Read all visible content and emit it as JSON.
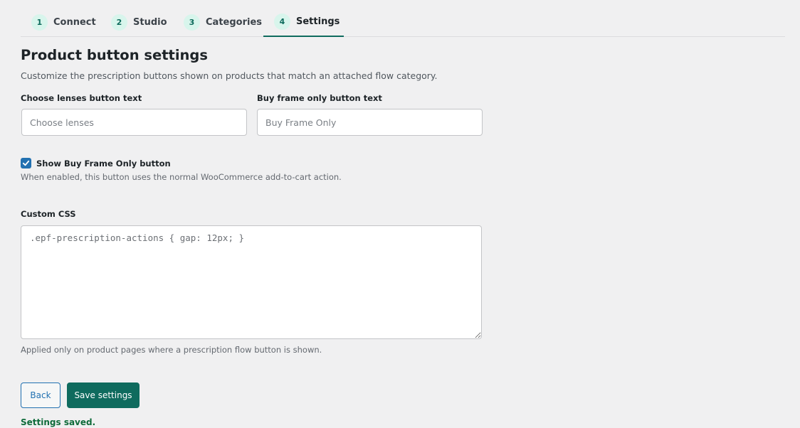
{
  "tabs": [
    {
      "num": "1",
      "label": "Connect"
    },
    {
      "num": "2",
      "label": "Studio"
    },
    {
      "num": "3",
      "label": "Categories"
    },
    {
      "num": "4",
      "label": "Settings"
    }
  ],
  "active_tab": "Settings",
  "page": {
    "title": "Product button settings",
    "subtitle": "Customize the prescription buttons shown on products that match an attached flow category."
  },
  "fields": {
    "choose_lenses": {
      "label": "Choose lenses button text",
      "value": "",
      "placeholder": "Choose lenses"
    },
    "buy_frame": {
      "label": "Buy frame only button text",
      "value": "",
      "placeholder": "Buy Frame Only"
    }
  },
  "show_buy_frame": {
    "label": "Show Buy Frame Only button",
    "checked": true,
    "hint": "When enabled, this button uses the normal WooCommerce add-to-cart action."
  },
  "custom_css": {
    "label": "Custom CSS",
    "value": "",
    "placeholder": ".epf-prescription-actions { gap: 12px; }",
    "hint": "Applied only on product pages where a prescription flow button is shown."
  },
  "buttons": {
    "back": "Back",
    "save": "Save settings"
  },
  "status": "Settings saved.",
  "colors": {
    "accent": "#0f6b5e",
    "link": "#2271b1",
    "tab_badge_bg": "#d8f5ec",
    "success": "#0f6b3a"
  }
}
